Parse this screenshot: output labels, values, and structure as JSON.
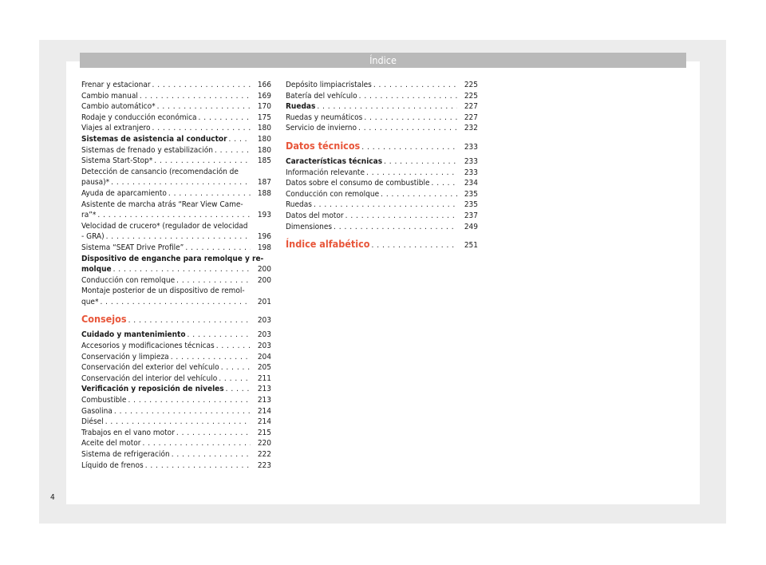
{
  "header": {
    "title": "Índice"
  },
  "left_column": [
    {
      "label": "Frenar y estacionar",
      "page": "166"
    },
    {
      "label": "Cambio manual",
      "page": "169"
    },
    {
      "label": "Cambio automático*",
      "page": "170"
    },
    {
      "label": "Rodaje y conducción económica",
      "page": "175"
    },
    {
      "label": "Viajes al extranjero",
      "page": "180"
    },
    {
      "label": "Sistemas de asistencia al conductor",
      "page": "180",
      "style": "bold"
    },
    {
      "label": "Sistemas de frenado y estabilización",
      "page": "180"
    },
    {
      "label": "Sistema Start-Stop*",
      "page": "185"
    },
    {
      "label": "Detección de cansancio (recomendación de",
      "cont": "pausa)*",
      "page": "187"
    },
    {
      "label": "Ayuda de aparcamiento",
      "page": "188"
    },
    {
      "label": "Asistente de marcha atrás “Rear View Came-",
      "cont": "ra”*",
      "page": "193"
    },
    {
      "label": "Velocidad de crucero* (regulador de velocidad",
      "cont": "- GRA)",
      "page": "196"
    },
    {
      "label": "Sistema “SEAT Drive Profile”",
      "page": "198"
    },
    {
      "label": "Dispositivo de enganche para remolque y re-",
      "cont": "molque",
      "page": "200",
      "style": "bold"
    },
    {
      "label": "Conducción con remolque",
      "page": "200"
    },
    {
      "label": "Montaje posterior de un dispositivo de remol-",
      "cont": "que*",
      "page": "201"
    },
    {
      "label": "Consejos",
      "page": "203",
      "style": "section"
    },
    {
      "label": "Cuidado y mantenimiento",
      "page": "203",
      "style": "bold"
    },
    {
      "label": "Accesorios y modificaciones técnicas",
      "page": "203"
    },
    {
      "label": "Conservación y limpieza",
      "page": "204"
    },
    {
      "label": "Conservación del exterior del vehículo",
      "page": "205"
    },
    {
      "label": "Conservación del interior del vehículo",
      "page": "211"
    },
    {
      "label": "Verificación y reposición de niveles",
      "page": "213",
      "style": "bold"
    },
    {
      "label": "Combustible",
      "page": "213"
    },
    {
      "label": "Gasolina",
      "page": "214"
    },
    {
      "label": "Diésel",
      "page": "214"
    },
    {
      "label": "Trabajos en el vano motor",
      "page": "215"
    },
    {
      "label": "Aceite del motor",
      "page": "220"
    },
    {
      "label": "Sistema de refrigeración",
      "page": "222"
    },
    {
      "label": "Líquido de frenos",
      "page": "223"
    }
  ],
  "right_column": [
    {
      "label": "Depósito limpiacristales",
      "page": "225"
    },
    {
      "label": "Batería del vehículo",
      "page": "225"
    },
    {
      "label": "Ruedas",
      "page": "227",
      "style": "bold"
    },
    {
      "label": "Ruedas y neumáticos",
      "page": "227"
    },
    {
      "label": "Servicio de invierno",
      "page": "232"
    },
    {
      "label": "Datos técnicos",
      "page": "233",
      "style": "section"
    },
    {
      "label": "Características técnicas",
      "page": "233",
      "style": "bold"
    },
    {
      "label": "Información relevante",
      "page": "233"
    },
    {
      "label": "Datos sobre el consumo de combustible",
      "page": "234"
    },
    {
      "label": "Conducción con remolque",
      "page": "235"
    },
    {
      "label": "Ruedas",
      "page": "235"
    },
    {
      "label": "Datos del motor",
      "page": "237"
    },
    {
      "label": "Dimensiones",
      "page": "249"
    },
    {
      "label": "Índice alfabético",
      "page": "251",
      "style": "section"
    }
  ],
  "page_number": "4",
  "colors": {
    "header_bg": "#b9b9b9",
    "section_accent": "#e8563a",
    "frame_bg": "#ececec"
  }
}
